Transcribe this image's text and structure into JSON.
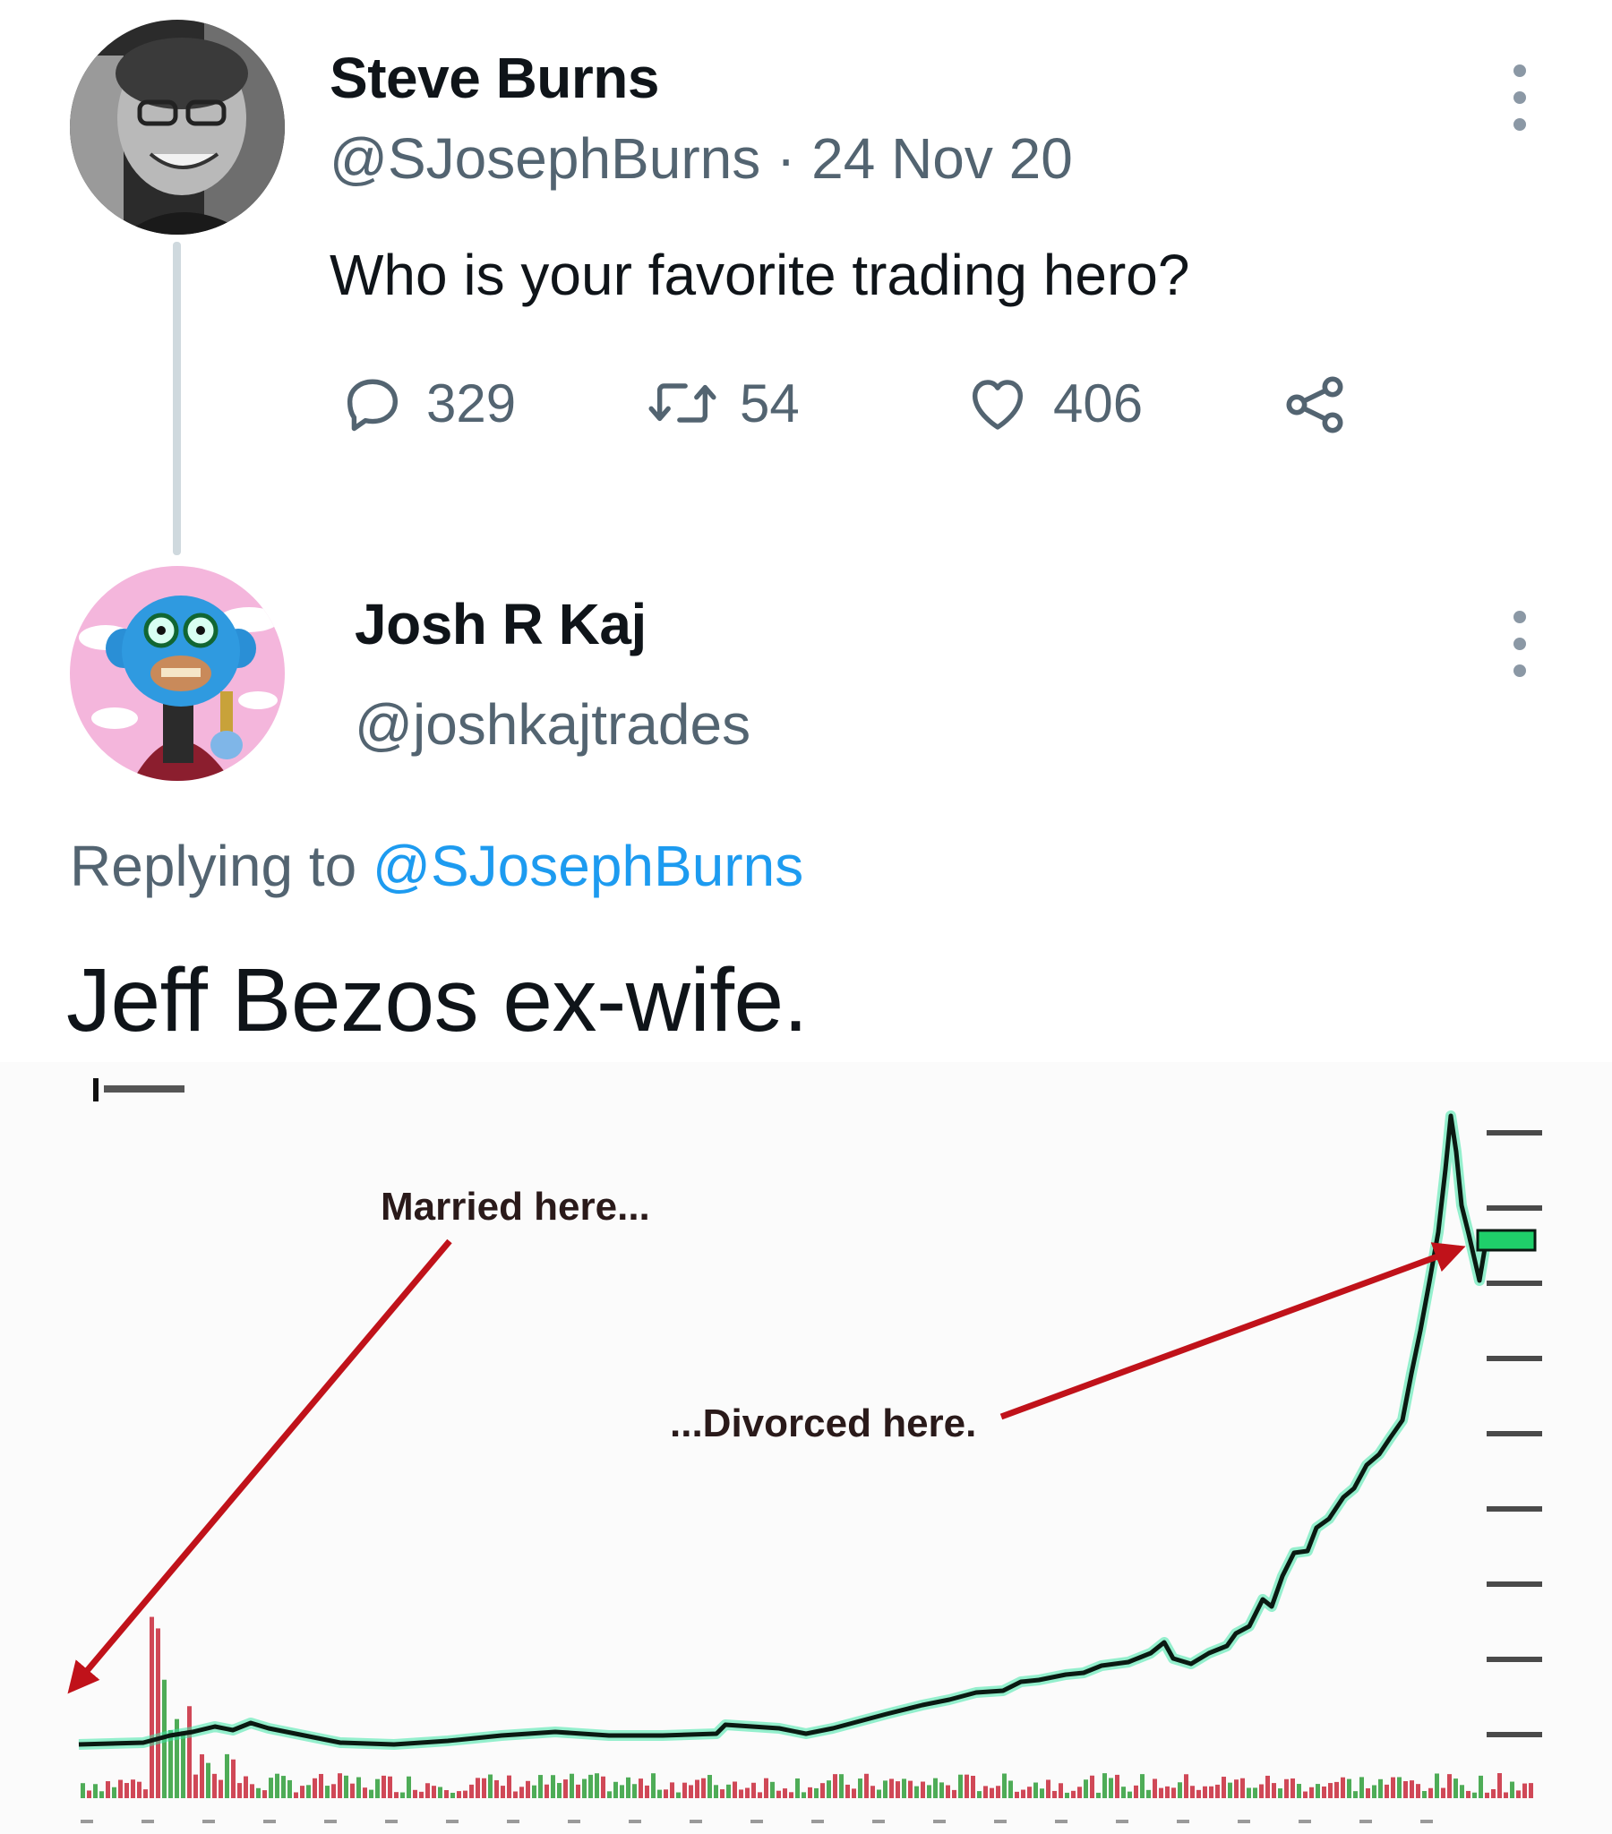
{
  "original_tweet": {
    "author_name": "Steve Burns",
    "author_handle": "@SJosephBurns",
    "separator": "·",
    "date": "24 Nov 20",
    "text": "Who is your favorite trading hero?",
    "stats": {
      "replies": "329",
      "retweets": "54",
      "likes": "406"
    }
  },
  "reply_tweet": {
    "author_name": "Josh R Kaj",
    "author_handle": "@joshkajtrades",
    "replying_to_prefix": "Replying to",
    "replying_to_handle": "@SJosephBurns",
    "text": "Jeff Bezos ex-wife."
  },
  "chart_image": {
    "annotation_married": "Married here...",
    "annotation_divorced": "...Divorced here.",
    "colors": {
      "price_line": "#0a1a12",
      "arrow": "#c0121a",
      "volume_up": "#2f9e3a",
      "volume_down": "#c8283a"
    }
  },
  "colors": {
    "link": "#1d9bf0",
    "secondary_text": "#536471",
    "thread_line": "#cfd9de"
  }
}
